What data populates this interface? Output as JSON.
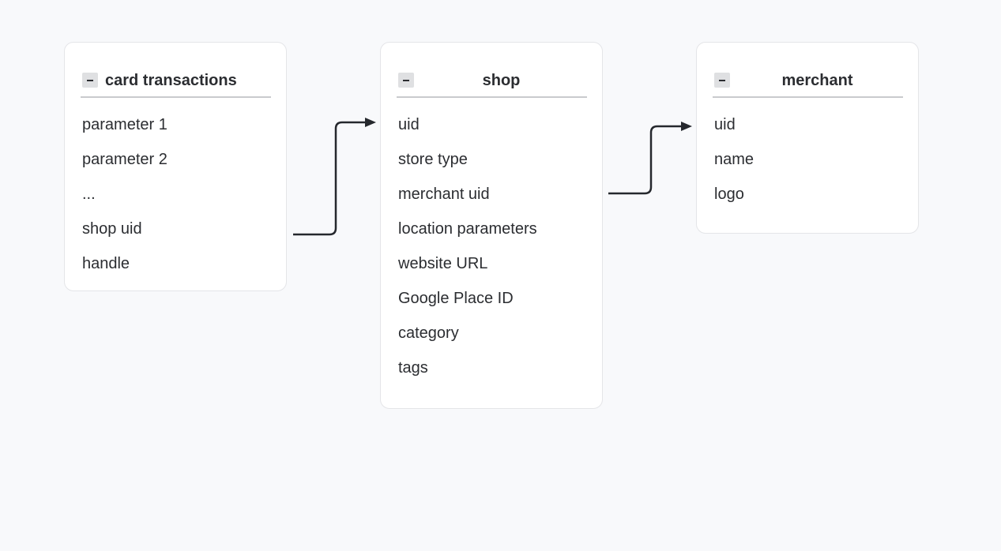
{
  "diagram": {
    "entities": [
      {
        "title": "card transactions",
        "fields": [
          "parameter 1",
          "parameter 2",
          "...",
          "shop uid",
          "handle"
        ]
      },
      {
        "title": "shop",
        "fields": [
          "uid",
          "store type",
          "merchant uid",
          "location parameters",
          "website URL",
          "Google Place ID",
          "category",
          "tags"
        ]
      },
      {
        "title": "merchant",
        "fields": [
          "uid",
          "name",
          "logo"
        ]
      }
    ],
    "relations": [
      {
        "from": "card transactions.shop uid",
        "to": "shop.uid"
      },
      {
        "from": "shop.merchant uid",
        "to": "merchant.uid"
      }
    ],
    "colors": {
      "background": "#f8f9fb",
      "card": "#ffffff",
      "card_border": "#e4e5e8",
      "text": "#2b2d31",
      "connector": "#25282d"
    },
    "icons": {
      "collapse": "minus-icon"
    }
  }
}
